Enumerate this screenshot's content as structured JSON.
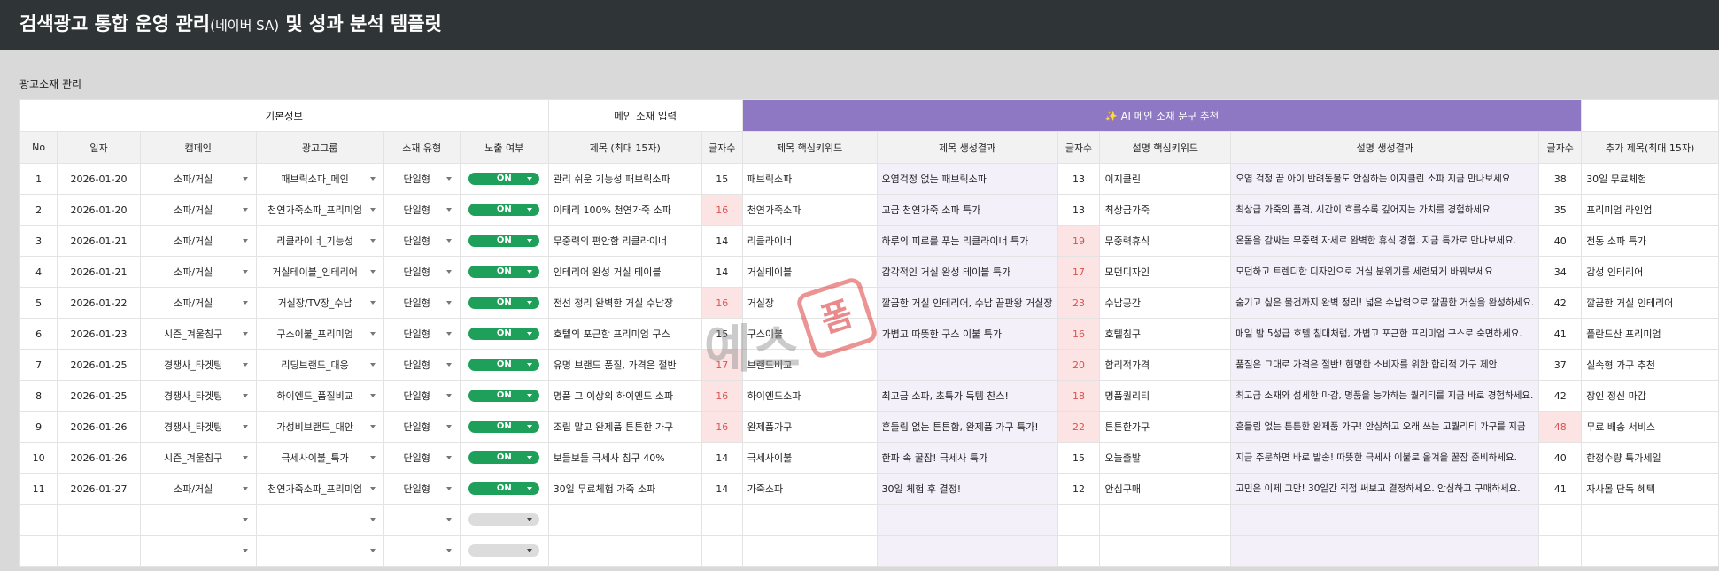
{
  "header": {
    "title_main": "검색광고 통합 운영 관리",
    "title_sub": "(네이버 SA)",
    "title_tail": " 및 성과 분석 템플릿"
  },
  "section": {
    "label": "광고소재 관리"
  },
  "groups": {
    "basic": "기본정보",
    "main_input": "메인 소재 입력",
    "ai": "✨ AI 메인 소재 문구 추천"
  },
  "columns": [
    "No",
    "일자",
    "캠페인",
    "광고그룹",
    "소재 유형",
    "노출 여부",
    "제목 (최대 15자)",
    "글자수",
    "제목 핵심키워드",
    "제목 생성결과",
    "글자수",
    "설명 핵심키워드",
    "설명 생성결과",
    "글자수",
    "추가 제목(최대 15자)"
  ],
  "rows": [
    {
      "no": "1",
      "date": "2026-01-20",
      "campaign": "소파/거실",
      "adgroup": "패브릭소파_메인",
      "type": "단일형",
      "status": "ON",
      "title": "관리 쉬운 기능성 패브릭소파",
      "title_len": "15",
      "title_kw": "패브릭소파",
      "title_gen": "오염걱정 없는 패브릭소파",
      "gen_len": "13",
      "desc_kw": "이지클린",
      "desc_gen": "오염 걱정 끝 아이 반려동물도 안심하는 이지클린 소파 지금 만나보세요",
      "desc_len": "38",
      "extra": "30일 무료체험"
    },
    {
      "no": "2",
      "date": "2026-01-20",
      "campaign": "소파/거실",
      "adgroup": "천연가죽소파_프리미엄",
      "type": "단일형",
      "status": "ON",
      "title": "이태리 100% 천연가죽 소파",
      "title_len": "16",
      "title_kw": "천연가죽소파",
      "title_gen": "고급 천연가죽 소파 특가",
      "gen_len": "13",
      "desc_kw": "최상급가죽",
      "desc_gen": "최상급 가죽의 품격, 시간이 흐를수록 깊어지는 가치를 경험하세요",
      "desc_len": "35",
      "extra": "프리미엄 라인업"
    },
    {
      "no": "3",
      "date": "2026-01-21",
      "campaign": "소파/거실",
      "adgroup": "리클라이너_기능성",
      "type": "단일형",
      "status": "ON",
      "title": "무중력의 편안함 리클라이너",
      "title_len": "14",
      "title_kw": "리클라이너",
      "title_gen": "하루의 피로를 푸는 리클라이너 특가",
      "gen_len": "19",
      "desc_kw": "무중력휴식",
      "desc_gen": "온몸을 감싸는 무중력 자세로 완벽한 휴식 경험. 지금 특가로 만나보세요.",
      "desc_len": "40",
      "extra": "전동 소파 특가"
    },
    {
      "no": "4",
      "date": "2026-01-21",
      "campaign": "소파/거실",
      "adgroup": "거실테이블_인테리어",
      "type": "단일형",
      "status": "ON",
      "title": "인테리어 완성 거실 테이블",
      "title_len": "14",
      "title_kw": "거실테이블",
      "title_gen": "감각적인 거실 완성 테이블 특가",
      "gen_len": "17",
      "desc_kw": "모던디자인",
      "desc_gen": "모던하고 트렌디한 디자인으로 거실 분위기를 세련되게 바꿔보세요",
      "desc_len": "34",
      "extra": "감성 인테리어"
    },
    {
      "no": "5",
      "date": "2026-01-22",
      "campaign": "소파/거실",
      "adgroup": "거실장/TV장_수납",
      "type": "단일형",
      "status": "ON",
      "title": "전선 정리 완벽한 거실 수납장",
      "title_len": "16",
      "title_kw": "거실장",
      "title_gen": "깔끔한 거실 인테리어, 수납 끝판왕 거실장",
      "gen_len": "23",
      "desc_kw": "수납공간",
      "desc_gen": "숨기고 싶은 물건까지 완벽 정리! 넓은 수납력으로 깔끔한 거실을 완성하세요.",
      "desc_len": "42",
      "extra": "깔끔한 거실 인테리어"
    },
    {
      "no": "6",
      "date": "2026-01-23",
      "campaign": "시즌_겨울침구",
      "adgroup": "구스이불_프리미엄",
      "type": "단일형",
      "status": "ON",
      "title": "호텔의 포근함 프리미엄 구스",
      "title_len": "15",
      "title_kw": "구스이불",
      "title_gen": "가볍고 따뜻한 구스 이불 특가",
      "gen_len": "16",
      "desc_kw": "호텔침구",
      "desc_gen": "매일 밤 5성급 호텔 침대처럼, 가볍고 포근한 프리미엄 구스로 숙면하세요.",
      "desc_len": "41",
      "extra": "폴란드산 프리미엄"
    },
    {
      "no": "7",
      "date": "2026-01-25",
      "campaign": "경쟁사_타겟팅",
      "adgroup": "리딩브랜드_대응",
      "type": "단일형",
      "status": "ON",
      "title": "유명 브랜드 품질, 가격은 절반",
      "title_len": "17",
      "title_kw": "브랜드비교",
      "title_gen": "",
      "gen_len": "20",
      "desc_kw": "합리적가격",
      "desc_gen": "품질은 그대로 가격은 절반! 현명한 소비자를 위한 합리적 가구 제안",
      "desc_len": "37",
      "extra": "실속형 가구 추천"
    },
    {
      "no": "8",
      "date": "2026-01-25",
      "campaign": "경쟁사_타겟팅",
      "adgroup": "하이엔드_품질비교",
      "type": "단일형",
      "status": "ON",
      "title": "명품 그 이상의 하이엔드 소파",
      "title_len": "16",
      "title_kw": "하이엔드소파",
      "title_gen": "최고급 소파, 초특가 득템 찬스!",
      "gen_len": "18",
      "desc_kw": "명품퀄리티",
      "desc_gen": "최고급 소재와 섬세한 마감, 명품을 능가하는 퀄리티를 지금 바로 경험하세요.",
      "desc_len": "42",
      "extra": "장인 정신 마감"
    },
    {
      "no": "9",
      "date": "2026-01-26",
      "campaign": "경쟁사_타겟팅",
      "adgroup": "가성비브랜드_대안",
      "type": "단일형",
      "status": "ON",
      "title": "조립 말고 완제품 튼튼한 가구",
      "title_len": "16",
      "title_kw": "완제품가구",
      "title_gen": "흔들림 없는 튼튼함, 완제품 가구 특가!",
      "gen_len": "22",
      "desc_kw": "튼튼한가구",
      "desc_gen": "흔들림 없는 튼튼한 완제품 가구! 안심하고 오래 쓰는 고퀄리티 가구를 지금",
      "desc_len": "48",
      "extra": "무료 배송 서비스"
    },
    {
      "no": "10",
      "date": "2026-01-26",
      "campaign": "시즌_겨울침구",
      "adgroup": "극세사이불_특가",
      "type": "단일형",
      "status": "ON",
      "title": "보들보들 극세사 침구 40%",
      "title_len": "14",
      "title_kw": "극세사이불",
      "title_gen": "한파 속 꿀잠! 극세사 특가",
      "gen_len": "15",
      "desc_kw": "오늘출발",
      "desc_gen": "지금 주문하면 바로 발송! 따뜻한 극세사 이불로 올겨울 꿀잠 준비하세요.",
      "desc_len": "40",
      "extra": "한정수량 특가세일"
    },
    {
      "no": "11",
      "date": "2026-01-27",
      "campaign": "소파/거실",
      "adgroup": "천연가죽소파_프리미엄",
      "type": "단일형",
      "status": "ON",
      "title": "30일 무료체험 가죽 소파",
      "title_len": "14",
      "title_kw": "가죽소파",
      "title_gen": "30일 체험 후 결정!",
      "gen_len": "12",
      "desc_kw": "안심구매",
      "desc_gen": "고민은 이제 그만! 30일간 직접 써보고 결정하세요. 안심하고 구매하세요.",
      "desc_len": "41",
      "extra": "자사몰 단독 혜택"
    }
  ],
  "watermark": {
    "text": "예스",
    "seal": "폼"
  },
  "colors": {
    "topbar": "#2f3437",
    "ai_header": "#8e78c4",
    "on_pill": "#1ea05a",
    "over_limit": "#fde4e4",
    "generated": "#f3f0fa"
  }
}
